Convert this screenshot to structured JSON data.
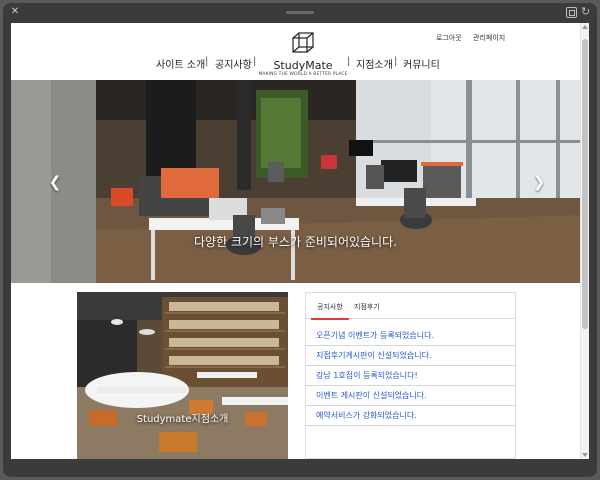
{
  "header": {
    "util_links": [
      "로그아웃",
      "관리페이지"
    ],
    "nav_left": [
      "사이트 소개",
      "공지사항"
    ],
    "nav_right": [
      "지점소개",
      "커뮤니티"
    ],
    "separator": "|",
    "logo": {
      "name": "StudyMate",
      "tagline": "MAKING THE WORLD A BETTER PLACE"
    }
  },
  "hero": {
    "caption": "다양한 크기의 부스가 준비되어있습니다.",
    "prev_icon": "chevron-left-icon",
    "next_icon": "chevron-right-icon"
  },
  "branch": {
    "caption": "Studymate지점소개"
  },
  "board": {
    "tabs": [
      "공지사항",
      "지점후기"
    ],
    "active_tab": "공지사항",
    "accent_color": "#e23b3b",
    "link_color": "#2458d6",
    "notices": [
      "오픈기념 이벤트가 등록되었습니다.",
      "지점후기게시판이 신설되었습니다.",
      "강남 1호점이 등록되었습니다!",
      "이벤트 게시판이 신설되었습니다.",
      "예약서비스가 강화되었습니다."
    ]
  },
  "window": {
    "icons": [
      "close-icon",
      "restore-icon",
      "refresh-icon"
    ]
  }
}
